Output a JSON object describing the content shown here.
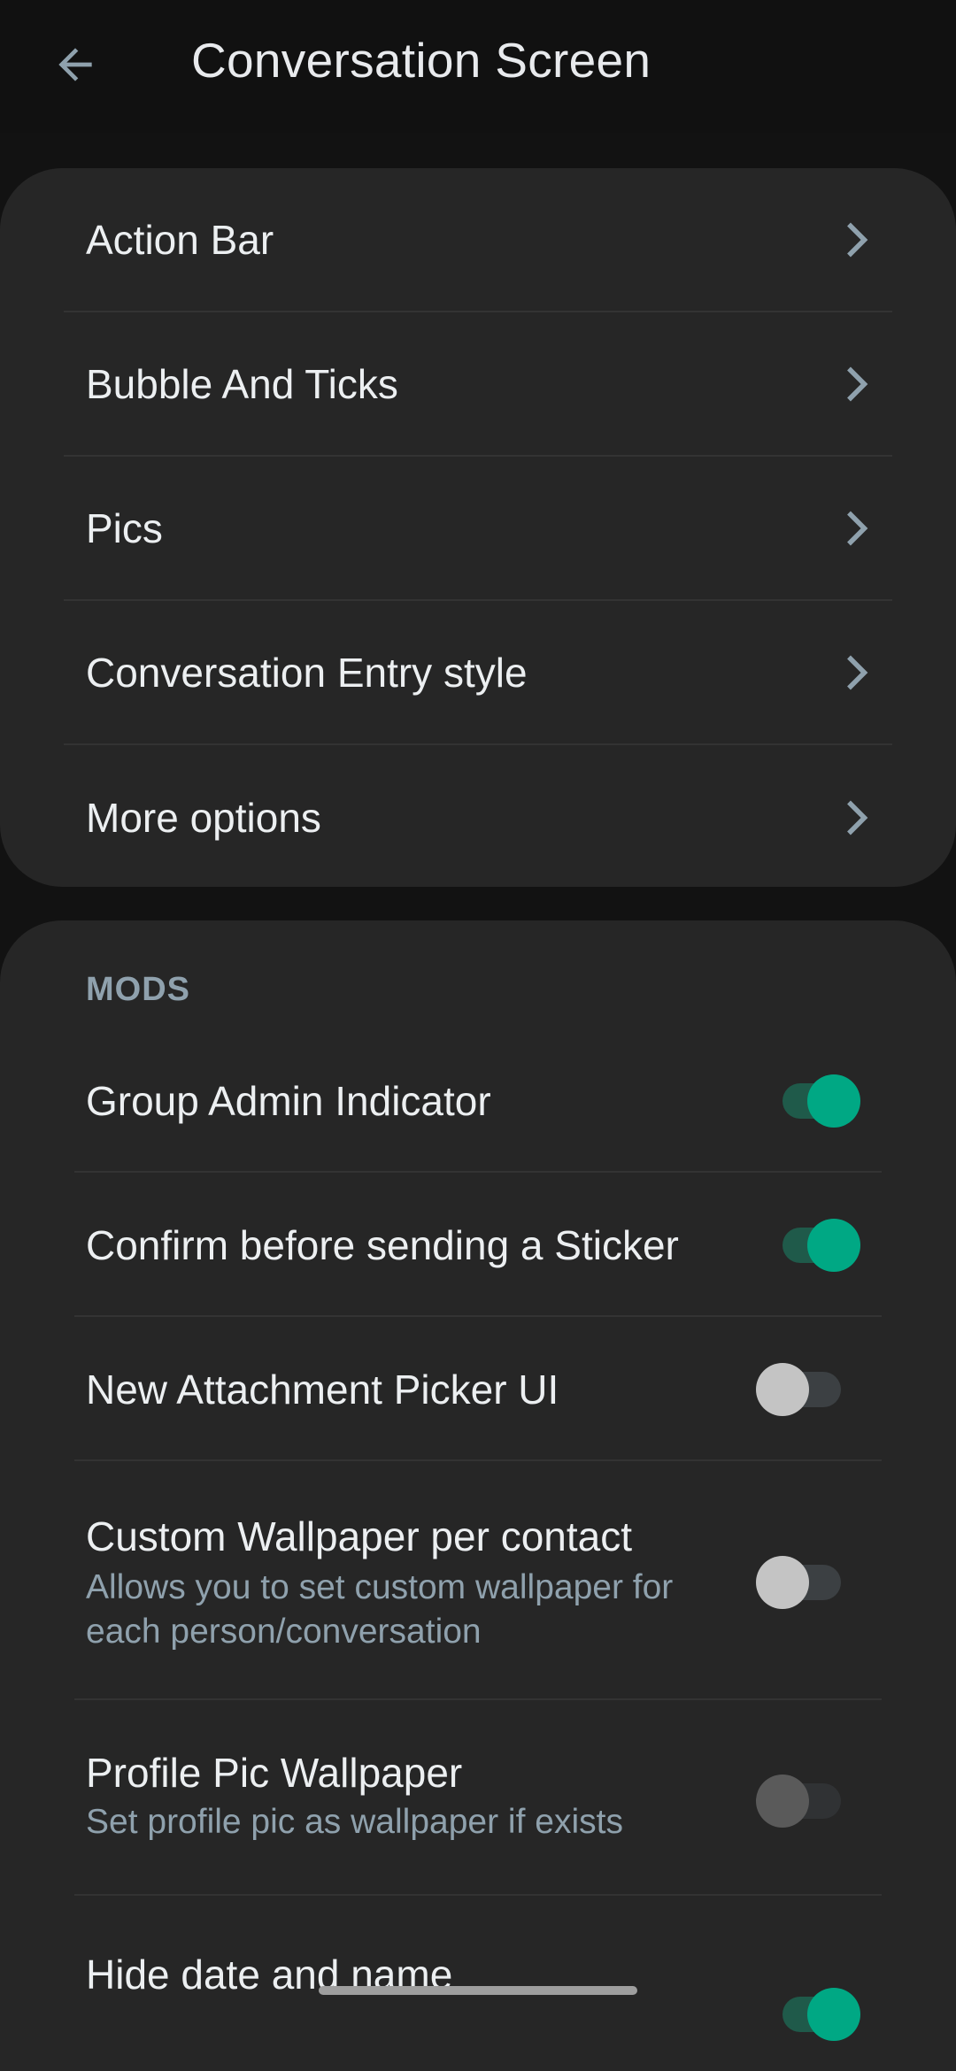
{
  "appbar": {
    "title": "Conversation Screen"
  },
  "nav_items": [
    {
      "label": "Action Bar"
    },
    {
      "label": "Bubble And Ticks"
    },
    {
      "label": "Pics"
    },
    {
      "label": "Conversation Entry style"
    },
    {
      "label": "More options"
    }
  ],
  "mods": {
    "header": "MODS",
    "items": [
      {
        "title": "Group Admin Indicator",
        "checked": true
      },
      {
        "title": "Confirm before sending a Sticker",
        "checked": true
      },
      {
        "title": "New Attachment Picker UI",
        "checked": false
      },
      {
        "title": "Custom Wallpaper per contact",
        "subtitle": "Allows you to set custom wallpaper for each person/conversation",
        "checked": false
      },
      {
        "title": "Profile Pic Wallpaper",
        "subtitle": "Set profile pic as wallpaper if exists",
        "checked": false
      },
      {
        "title": "Hide date and name",
        "checked": true
      }
    ]
  },
  "colors": {
    "background": "#121212",
    "card": "#262626",
    "accent": "#00a884",
    "subtext": "#8fa1ad"
  },
  "icons": {
    "back": "arrow-back-icon",
    "nav": "chevron-right-icon"
  }
}
